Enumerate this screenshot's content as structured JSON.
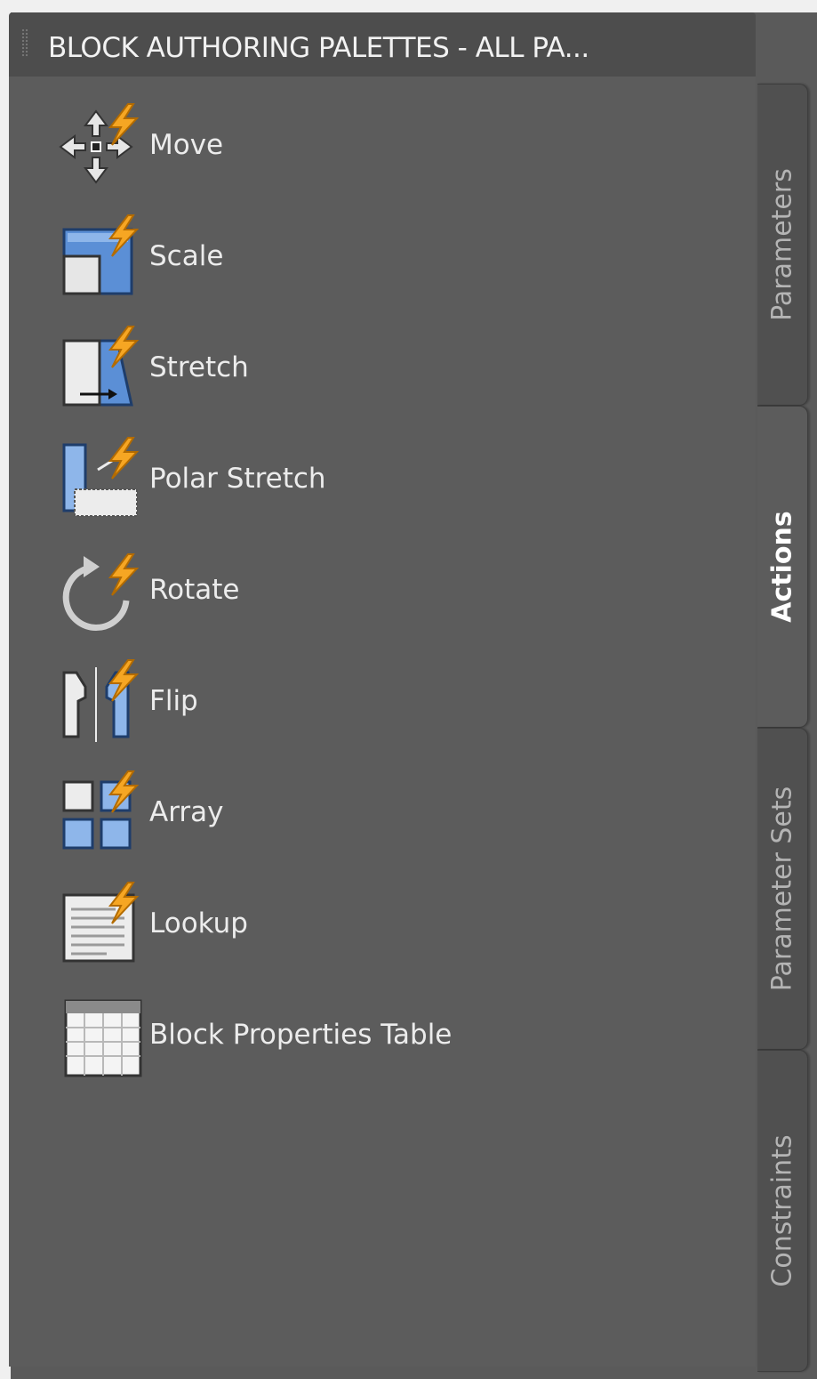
{
  "palette": {
    "title": "BLOCK AUTHORING PALETTES - ALL PA..."
  },
  "items": [
    {
      "label": "Move",
      "icon": "move-action-icon"
    },
    {
      "label": "Scale",
      "icon": "scale-action-icon"
    },
    {
      "label": "Stretch",
      "icon": "stretch-action-icon"
    },
    {
      "label": "Polar Stretch",
      "icon": "polar-stretch-action-icon"
    },
    {
      "label": "Rotate",
      "icon": "rotate-action-icon"
    },
    {
      "label": "Flip",
      "icon": "flip-action-icon"
    },
    {
      "label": "Array",
      "icon": "array-action-icon"
    },
    {
      "label": "Lookup",
      "icon": "lookup-action-icon"
    },
    {
      "label": "Block Properties Table",
      "icon": "block-properties-table-icon"
    }
  ],
  "tabs": [
    {
      "label": "Parameters",
      "active": false
    },
    {
      "label": "Actions",
      "active": true
    },
    {
      "label": "Parameter Sets",
      "active": false
    },
    {
      "label": "Constraints",
      "active": false
    }
  ],
  "colors": {
    "panel": "#5c5c5c",
    "titlebar": "#4d4d4d",
    "accent_blue": "#5b8fd6",
    "lightning": "#f6a623"
  }
}
